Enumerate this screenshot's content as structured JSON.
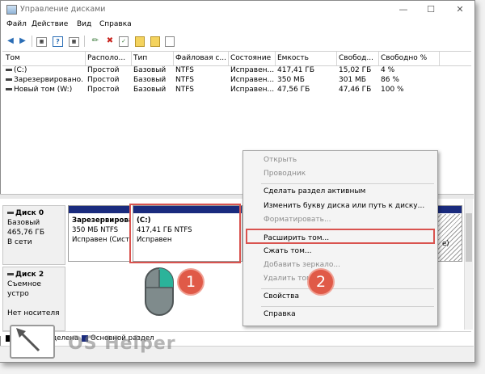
{
  "window": {
    "title": "Управление дисками",
    "minimize": "—",
    "maximize": "☐",
    "close": "✕"
  },
  "menu": [
    "Файл",
    "Действие",
    "Вид",
    "Справка"
  ],
  "columns": [
    "Том",
    "Располо...",
    "Тип",
    "Файловая с...",
    "Состояние",
    "Емкость",
    "Свобод...",
    "Свободно %"
  ],
  "volumes": [
    {
      "name": "(C:)",
      "layout": "Простой",
      "type": "Базовый",
      "fs": "NTFS",
      "status": "Исправен...",
      "capacity": "417,41 ГБ",
      "free": "15,02 ГБ",
      "free_pct": "4 %"
    },
    {
      "name": "Зарезервировано...",
      "layout": "Простой",
      "type": "Базовый",
      "fs": "NTFS",
      "status": "Исправен...",
      "capacity": "350 МБ",
      "free": "301 МБ",
      "free_pct": "86 %"
    },
    {
      "name": "Новый том (W:)",
      "layout": "Простой",
      "type": "Базовый",
      "fs": "NTFS",
      "status": "Исправен...",
      "capacity": "47,56 ГБ",
      "free": "47,46 ГБ",
      "free_pct": "100 %"
    }
  ],
  "disk0": {
    "name": "Диск 0",
    "type": "Базовый",
    "size": "465,76 ГБ",
    "state": "В сети",
    "p1": {
      "name": "Зарезервирова",
      "size": "350 МБ NTFS",
      "status": "Исправен (Сист"
    },
    "p2": {
      "name": "(C:)",
      "size": "417,41 ГБ NTFS",
      "status": "Исправен"
    },
    "p3_tail": "e)"
  },
  "disk2": {
    "name": "Диск 2",
    "type": "Съемное устро",
    "state": "Нет носителя"
  },
  "legend": {
    "unallocated": "Не распределена",
    "primary": "Основной раздел"
  },
  "context_menu": {
    "open": "Открыть",
    "explorer": "Проводник",
    "mark_active": "Сделать раздел активным",
    "change_letter": "Изменить букву диска или путь к диску...",
    "format": "Форматировать...",
    "extend": "Расширить том...",
    "shrink": "Сжать том...",
    "add_mirror": "Добавить зеркало...",
    "delete": "Удалить том...",
    "properties": "Свойства",
    "help": "Справка"
  },
  "badges": [
    "1",
    "2"
  ],
  "watermark": "OS Helper",
  "colors": {
    "accent_red": "#d9534f",
    "partition_bar": "#1a2b7e",
    "badge": "#e05a48",
    "mouse_green": "#2bb39a"
  }
}
